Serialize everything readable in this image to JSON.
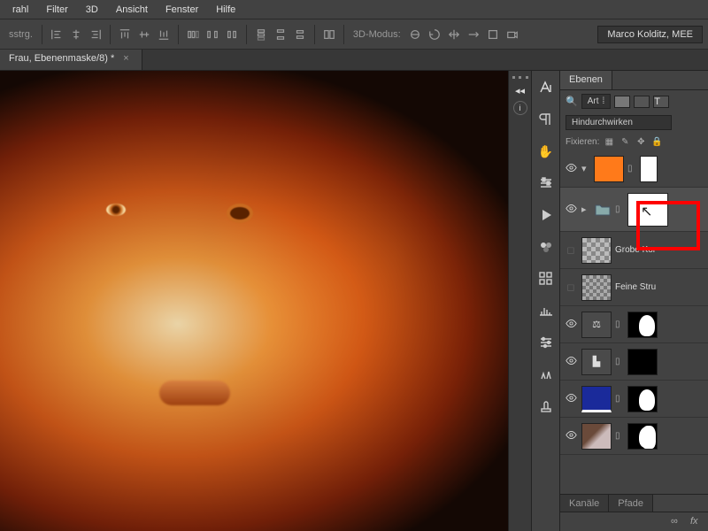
{
  "menubar": [
    "rahl",
    "Filter",
    "3D",
    "Ansicht",
    "Fenster",
    "Hilfe"
  ],
  "optbar": {
    "left_label": "sstrg.",
    "mode_label": "3D-Modus:",
    "user": "Marco Kolditz, MEE"
  },
  "doc_tab": "Frau, Ebenenmaske/8) *",
  "panel": {
    "tab_layers": "Ebenen",
    "search_label": "Art",
    "blend_mode": "Hindurchwirken",
    "lock_label": "Fixieren:",
    "tab_kanaele": "Kanäle",
    "tab_pfade": "Pfade"
  },
  "layers": [
    {
      "name": "",
      "thumb": "orange",
      "mask": ""
    },
    {
      "name": "",
      "thumb": "folder-white",
      "mask": "",
      "grouped": true
    },
    {
      "name": "Grobe Kor",
      "thumb": "checker",
      "mask": ""
    },
    {
      "name": "Feine Stru",
      "thumb": "checker-gray",
      "mask": ""
    },
    {
      "name": "",
      "thumb": "balance",
      "mask": "silh"
    },
    {
      "name": "",
      "thumb": "levels",
      "mask": "black"
    },
    {
      "name": "",
      "thumb": "blue",
      "mask": "silh"
    },
    {
      "name": "",
      "thumb": "photo",
      "mask": "silh2"
    }
  ]
}
